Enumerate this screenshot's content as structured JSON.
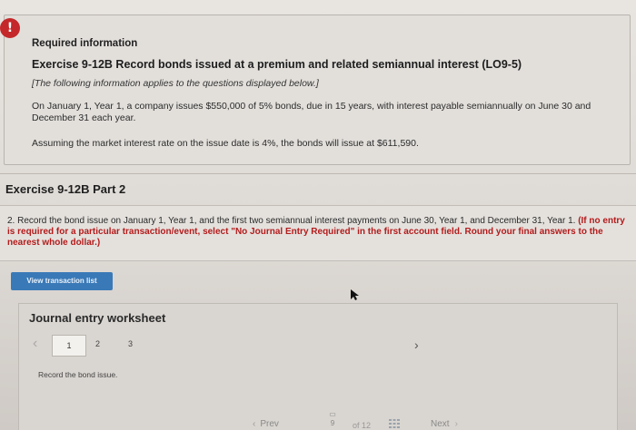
{
  "info": {
    "alert_symbol": "!",
    "title": "Required information",
    "heading": "Exercise 9-12B Record bonds issued at a premium and related semiannual interest (LO9-5)",
    "note": "[The following information applies to the questions displayed below.]",
    "para1": "On January 1, Year 1, a company issues $550,000 of 5% bonds, due in 15 years, with interest payable semiannually on June 30 and December 31 each year.",
    "para2": "Assuming the market interest rate on the issue date is 4%, the bonds will issue at $611,590."
  },
  "part": {
    "title": "Exercise 9-12B Part 2"
  },
  "question": {
    "text": "2. Record the bond issue on January 1, Year 1, and the first two semiannual interest payments on June 30, Year 1, and December 31, Year 1.",
    "instruction": "(If no entry is required for a particular transaction/event, select \"No Journal Entry Required\" in the first account field. Round your final answers to the nearest whole dollar.)"
  },
  "buttons": {
    "view_transaction_list": "View transaction list"
  },
  "journal": {
    "title": "Journal entry worksheet",
    "pages": [
      "1",
      "2",
      "3"
    ],
    "current_page": "1",
    "record_label": "Record the bond issue."
  },
  "nav": {
    "prev": "Prev",
    "page": "9",
    "of": "of 12",
    "next": "Next"
  },
  "colors": {
    "alert": "#c4282a",
    "button": "#3a79b7",
    "instruction_red": "#b31b1b"
  }
}
